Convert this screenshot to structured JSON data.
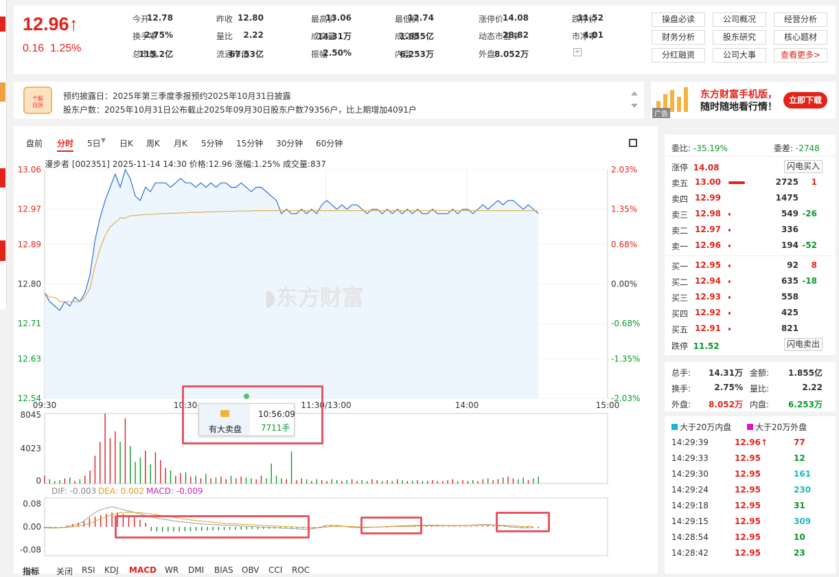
{
  "quote": {
    "price": "12.96↑",
    "change": "0.16",
    "change_pct": "1.25%"
  },
  "fields": [
    {
      "l": "今开",
      "v": "12.78",
      "c": "green"
    },
    {
      "l": "昨收",
      "v": "12.80",
      "c": ""
    },
    {
      "l": "最高价",
      "v": "13.06",
      "c": "red"
    },
    {
      "l": "最低价",
      "v": "12.74",
      "c": "green"
    },
    {
      "l": "涨停价",
      "v": "14.08",
      "c": "red"
    },
    {
      "l": "跌停价",
      "v": "11.52",
      "c": "green"
    },
    {
      "l": "换手率",
      "v": "2.75%",
      "c": ""
    },
    {
      "l": "量比",
      "v": "2.22",
      "c": ""
    },
    {
      "l": "成交量",
      "v": "14.31万",
      "c": ""
    },
    {
      "l": "成交额",
      "v": "1.855亿",
      "c": ""
    },
    {
      "l": "动态市盈率",
      "v": "28.82",
      "c": ""
    },
    {
      "l": "市净率",
      "v": "4.01",
      "c": ""
    },
    {
      "l": "总市值",
      "v": "115.2亿",
      "c": ""
    },
    {
      "l": "流通市值",
      "v": "67.53亿",
      "c": ""
    },
    {
      "l": "振幅",
      "v": "2.50%",
      "c": ""
    },
    {
      "l": "内盘",
      "v": "6.253万",
      "c": "green"
    },
    {
      "l": "外盘",
      "v": "8.052万",
      "c": "red"
    }
  ],
  "buttons": [
    "操盘必读",
    "公司概况",
    "经营分析",
    "财务分析",
    "股东研究",
    "核心题材",
    "分红融资",
    "公司大事",
    "查看更多>"
  ],
  "notice": {
    "badge_top": "个股",
    "badge_bottom": "日历",
    "line1": "预约披露日：2025年第三季度季报预约2025年10月31日披露",
    "line2": "股东户数：2025年10月31日公布截止2025年09月30日股东户数79356户，比上期增加4091户"
  },
  "ad": {
    "title": "东方财富手机版，",
    "subtitle": "随时随地看行情！",
    "download": "立即下载",
    "tag": "广告"
  },
  "tabs": [
    "盘前",
    "分时",
    "5日",
    "日K",
    "周K",
    "月K",
    "5分钟",
    "15分钟",
    "30分钟",
    "60分钟"
  ],
  "chart_info": "漫步者 [002351]  2025-11-14 14:30  价格:12.96  涨幅:1.25%  成交量:837",
  "watermark": "东方财富",
  "chart_data": {
    "type": "line",
    "x_labels": [
      "09:30",
      "10:30",
      "11:30/13:00",
      "14:00",
      "15:00"
    ],
    "y_left": [
      "13.06",
      "12.97",
      "12.89",
      "12.80",
      "12.71",
      "12.63",
      "12.54"
    ],
    "y_right": [
      "2.03%",
      "1.35%",
      "0.68%",
      "0.00%",
      "-0.68%",
      "-1.35%",
      "-2.03%"
    ],
    "ylim": [
      12.54,
      13.06
    ],
    "prev_close": 12.8,
    "price": [
      12.78,
      12.76,
      12.75,
      12.74,
      12.76,
      12.75,
      12.77,
      12.76,
      12.78,
      12.82,
      12.9,
      12.95,
      12.99,
      13.02,
      13.05,
      13.02,
      13.06,
      13.04,
      13.0,
      12.99,
      13.02,
      13.01,
      13.03,
      13.03,
      13.03,
      13.02,
      13.03,
      13.04,
      13.03,
      13.03,
      13.02,
      13.03,
      13.02,
      13.03,
      13.02,
      13.03,
      13.03,
      13.02,
      13.02,
      13.03,
      13.02,
      13.01,
      13.02,
      13.02,
      13.01,
      13.0,
      12.99,
      12.96,
      12.97,
      12.96,
      12.96,
      12.97,
      12.96,
      12.97,
      12.96,
      12.98,
      12.99,
      12.98,
      12.97,
      12.98,
      12.97,
      12.98,
      12.98,
      12.97,
      12.96,
      12.97,
      12.97,
      12.96,
      12.97,
      12.96,
      12.97,
      12.96,
      12.97,
      12.96,
      12.97,
      12.96,
      12.96,
      12.97,
      12.96,
      12.96,
      12.96,
      12.97,
      12.96,
      12.97,
      12.97,
      12.96,
      12.97,
      12.98,
      12.97,
      12.98,
      12.99,
      12.98,
      12.99,
      12.99,
      12.98,
      12.97,
      12.98,
      12.97,
      12.96
    ],
    "avg": [
      12.78,
      12.77,
      12.77,
      12.76,
      12.76,
      12.76,
      12.76,
      12.76,
      12.77,
      12.79,
      12.84,
      12.88,
      12.91,
      12.93,
      12.94,
      12.95,
      12.95,
      12.955,
      12.956,
      12.957,
      12.958,
      12.958,
      12.959,
      12.96,
      12.96,
      12.961,
      12.961,
      12.962,
      12.962,
      12.963,
      12.963,
      12.963,
      12.964,
      12.964,
      12.964,
      12.965,
      12.965,
      12.965,
      12.966,
      12.966,
      12.966,
      12.966,
      12.967,
      12.967,
      12.967,
      12.967,
      12.967,
      12.967,
      12.967,
      12.967,
      12.967,
      12.967,
      12.967,
      12.967,
      12.967,
      12.967,
      12.967,
      12.967,
      12.967,
      12.967,
      12.967,
      12.967,
      12.967,
      12.967,
      12.967,
      12.967,
      12.967,
      12.967,
      12.967,
      12.967,
      12.967,
      12.967,
      12.967,
      12.967,
      12.967,
      12.967,
      12.967,
      12.967,
      12.967,
      12.967,
      12.967,
      12.967,
      12.967,
      12.967,
      12.967,
      12.967,
      12.967,
      12.967,
      12.967,
      12.967,
      12.967,
      12.967,
      12.967,
      12.967,
      12.967,
      12.967,
      12.967,
      12.967,
      12.967
    ],
    "volume_axis": [
      "8045",
      "4023",
      "0"
    ],
    "volume_max": 8045,
    "volume": [
      900,
      500,
      300,
      400,
      600,
      700,
      300,
      500,
      900,
      1500,
      3200,
      4800,
      8045,
      5200,
      6000,
      4800,
      7500,
      4300,
      2500,
      3000,
      3800,
      2200,
      3600,
      2700,
      1800,
      1500,
      900,
      1200,
      1300,
      800,
      900,
      600,
      1100,
      600,
      700,
      800,
      500,
      900,
      600,
      800,
      700,
      600,
      500,
      900,
      600,
      2300,
      900,
      600,
      500,
      3700,
      400,
      600,
      500,
      300,
      500,
      400,
      300,
      500,
      400,
      300,
      400,
      500,
      300,
      400,
      300,
      500,
      400,
      300,
      400,
      300,
      500,
      400,
      300,
      300,
      400,
      300,
      300,
      400,
      300,
      300,
      400,
      500,
      300,
      400,
      300,
      400,
      300,
      500,
      600,
      400,
      500,
      700,
      800,
      600,
      500,
      700,
      400,
      600,
      800
    ],
    "macd_axis": [
      "0.08",
      "0.00",
      "-0.08"
    ],
    "macd_legend": {
      "dif": "DIF: -0.003",
      "dea": "DEA: 0.002",
      "macd": "MACD: -0.009"
    },
    "macd_lim": [
      -0.1,
      0.1
    ],
    "macd_hist": [
      -0.005,
      -0.006,
      -0.004,
      -0.003,
      0.005,
      0.01,
      0.015,
      0.02,
      0.03,
      0.035,
      0.04,
      0.045,
      0.05,
      0.05,
      0.045,
      0.04,
      0.035,
      0.025,
      0.015,
      -0.015,
      -0.016,
      -0.017,
      -0.017,
      -0.016,
      -0.016,
      -0.015,
      -0.015,
      -0.014,
      -0.014,
      -0.013,
      -0.012,
      -0.012,
      -0.011,
      -0.01,
      -0.01,
      -0.009,
      -0.009,
      -0.008,
      -0.008,
      -0.007,
      -0.007,
      -0.006,
      -0.006,
      -0.006,
      -0.005,
      -0.005,
      -0.005,
      -0.004,
      -0.004,
      -0.004,
      0.003,
      0.004,
      0.004,
      0.003,
      0.002,
      -0.002,
      -0.003,
      -0.003,
      -0.002,
      -0.002,
      -0.002,
      -0.002,
      0.001,
      0.002,
      0.002,
      0.002,
      0.002,
      0.003,
      0.003,
      0.003,
      0.003,
      0.002,
      0.002,
      0.002,
      0.002,
      0.002,
      0.002,
      0.002,
      0.003,
      0.004,
      0.004,
      0.003,
      0.003,
      -0.002,
      -0.003,
      -0.003,
      -0.004,
      -0.004,
      -0.005
    ],
    "macd_dif": [
      -0.003,
      -0.004,
      -0.004,
      -0.003,
      0.0,
      0.005,
      0.01,
      0.02,
      0.035,
      0.05,
      0.06,
      0.065,
      0.07,
      0.065,
      0.06,
      0.055,
      0.05,
      0.045,
      0.04,
      0.035,
      0.03,
      0.027,
      0.024,
      0.021,
      0.018,
      0.016,
      0.014,
      0.012,
      0.01,
      0.009,
      0.008,
      0.007,
      0.006,
      0.005,
      0.004,
      0.003,
      0.002,
      0.001,
      0.0,
      -0.001,
      -0.002,
      -0.003,
      -0.004,
      -0.005,
      -0.006,
      -0.007,
      -0.008,
      -0.008,
      -0.006,
      -0.002,
      0.004,
      0.006,
      0.005,
      0.003,
      0.0,
      -0.002,
      -0.003,
      -0.003,
      -0.002,
      -0.001,
      0.0,
      0.001,
      0.002,
      0.003,
      0.004,
      0.004,
      0.005,
      0.005,
      0.006,
      0.006,
      0.006,
      0.005,
      0.005,
      0.005,
      0.005,
      0.005,
      0.006,
      0.007,
      0.008,
      0.008,
      0.007,
      0.005,
      0.003,
      0.0,
      -0.002,
      -0.003,
      -0.003,
      -0.003
    ],
    "macd_dea": [
      -0.002,
      -0.002,
      -0.003,
      -0.003,
      -0.002,
      0.0,
      0.003,
      0.007,
      0.012,
      0.02,
      0.028,
      0.035,
      0.042,
      0.047,
      0.05,
      0.051,
      0.05,
      0.049,
      0.047,
      0.045,
      0.042,
      0.039,
      0.036,
      0.033,
      0.03,
      0.027,
      0.024,
      0.022,
      0.02,
      0.018,
      0.016,
      0.014,
      0.012,
      0.011,
      0.01,
      0.009,
      0.008,
      0.007,
      0.006,
      0.005,
      0.004,
      0.003,
      0.002,
      0.001,
      0.0,
      -0.001,
      -0.002,
      -0.003,
      -0.003,
      -0.003,
      -0.001,
      0.001,
      0.002,
      0.002,
      0.002,
      0.001,
      0.0,
      -0.001,
      -0.001,
      -0.001,
      0.0,
      0.0,
      0.001,
      0.001,
      0.002,
      0.002,
      0.003,
      0.003,
      0.004,
      0.004,
      0.004,
      0.004,
      0.004,
      0.004,
      0.004,
      0.004,
      0.005,
      0.005,
      0.006,
      0.006,
      0.006,
      0.006,
      0.005,
      0.004,
      0.003,
      0.002,
      0.002,
      0.002
    ]
  },
  "tooltip": {
    "label": "有大卖盘",
    "time": "10:56:09",
    "volume": "7711手"
  },
  "bottom_tabs": [
    "指标",
    "关闭",
    "RSI",
    "KDJ",
    "MACD",
    "WR",
    "DMI",
    "BIAS",
    "OBV",
    "CCI",
    "ROC"
  ],
  "book": {
    "weibi_label": "委比:",
    "weibi": "-35.19%",
    "weicha_label": "委差:",
    "weicha": "-2748",
    "limit_up_label": "涨停",
    "limit_up": "14.08",
    "buy_flash": "闪电买入",
    "limit_down_label": "跌停",
    "limit_down": "11.52",
    "sell_flash": "闪电卖出",
    "asks": [
      {
        "l": "卖五",
        "p": "13.00",
        "v": "2725",
        "d": "1",
        "dc": "red",
        "bar": 1
      },
      {
        "l": "卖四",
        "p": "12.99",
        "v": "1475",
        "d": "",
        "dc": "",
        "bar": 0
      },
      {
        "l": "卖三",
        "p": "12.98",
        "v": "549",
        "d": "-26",
        "dc": "green",
        "bar": 0.08
      },
      {
        "l": "卖二",
        "p": "12.97",
        "v": "336",
        "d": "",
        "dc": "",
        "bar": 0.05
      },
      {
        "l": "卖一",
        "p": "12.96",
        "v": "194",
        "d": "-52",
        "dc": "green",
        "bar": 0.04
      }
    ],
    "bids": [
      {
        "l": "买一",
        "p": "12.95",
        "v": "92",
        "d": "8",
        "dc": "red",
        "bar": 0.03
      },
      {
        "l": "买二",
        "p": "12.94",
        "v": "635",
        "d": "-18",
        "dc": "green",
        "bar": 0.08
      },
      {
        "l": "买三",
        "p": "12.93",
        "v": "558",
        "d": "",
        "dc": "",
        "bar": 0.08
      },
      {
        "l": "买四",
        "p": "12.92",
        "v": "425",
        "d": "",
        "dc": "",
        "bar": 0.07
      },
      {
        "l": "买五",
        "p": "12.91",
        "v": "821",
        "d": "",
        "dc": "",
        "bar": 0.1
      }
    ]
  },
  "summary": [
    {
      "l": "总手:",
      "v": "14.31万",
      "c": "",
      "l2": "金额:",
      "v2": "1.855亿",
      "c2": ""
    },
    {
      "l": "换手:",
      "v": "2.75%",
      "c": "",
      "l2": "量比:",
      "v2": "2.22",
      "c2": ""
    },
    {
      "l": "外盘:",
      "v": "8.052万",
      "c": "red",
      "l2": "内盘:",
      "v2": "6.253万",
      "c2": "green"
    }
  ],
  "legend": {
    "inner": "大于20万内盘",
    "outer": "大于20万外盘"
  },
  "trades": [
    {
      "t": "14:29:39",
      "p": "12.96↑",
      "v": "77",
      "vc": "red"
    },
    {
      "t": "14:29:33",
      "p": "12.95",
      "v": "12",
      "vc": "green"
    },
    {
      "t": "14:29:30",
      "p": "12.95",
      "v": "161",
      "vc": "teal"
    },
    {
      "t": "14:29:24",
      "p": "12.95",
      "v": "230",
      "vc": "teal"
    },
    {
      "t": "14:29:18",
      "p": "12.95",
      "v": "31",
      "vc": "green"
    },
    {
      "t": "14:29:15",
      "p": "12.95",
      "v": "309",
      "vc": "teal"
    },
    {
      "t": "14:28:54",
      "p": "12.95",
      "v": "10",
      "vc": "green"
    },
    {
      "t": "14:28:42",
      "p": "12.95",
      "v": "23",
      "vc": "green"
    }
  ]
}
